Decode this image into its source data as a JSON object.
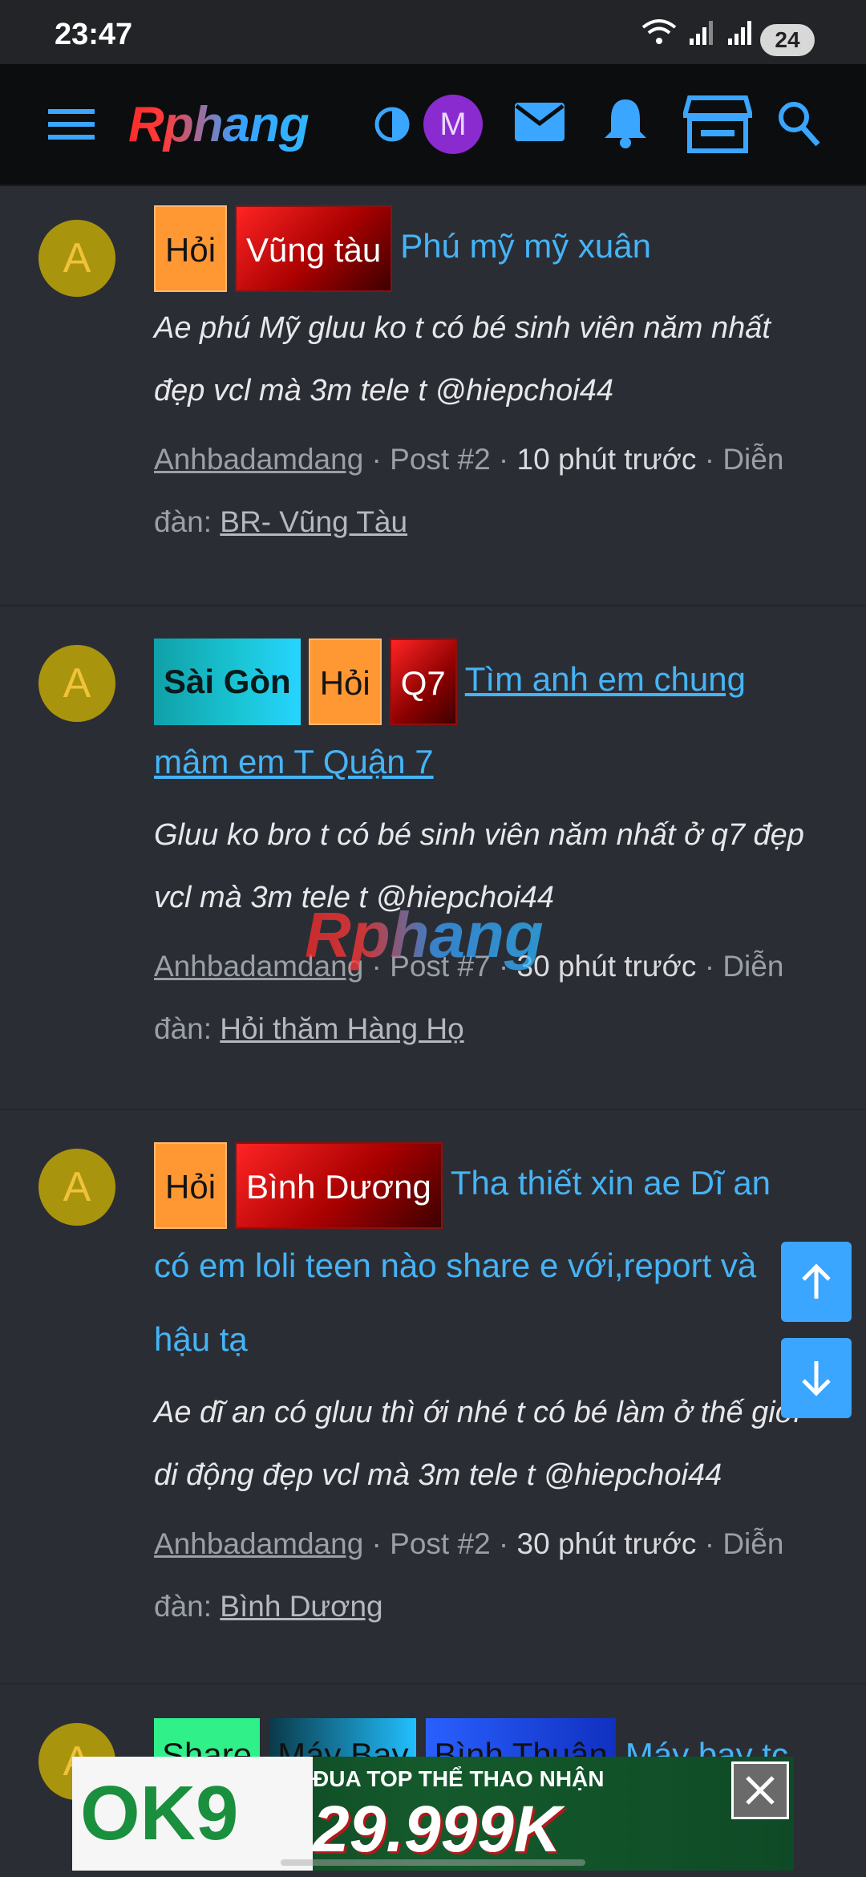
{
  "status_bar": {
    "time": "23:47",
    "battery": "24"
  },
  "nav": {
    "logo": "Rphang",
    "avatar_initial": "M"
  },
  "posts": [
    {
      "avatar": "A",
      "tags": [
        "Hỏi",
        "Vũng tàu"
      ],
      "title": "Phú mỹ mỹ xuân",
      "snippet": "Ae phú Mỹ gluu ko t có bé sinh viên năm nhất đẹp vcl mà 3m tele t @hiepchoi44",
      "user": "Anhbadamdang",
      "post_no": "Post #2",
      "time": "10 phút trước",
      "forum_label": "Diễn đàn:",
      "forum": "BR- Vũng Tàu"
    },
    {
      "avatar": "A",
      "tags": [
        "Sài Gòn",
        "Hỏi",
        "Q7"
      ],
      "title": "Tìm anh em chung mâm em T Quận 7",
      "snippet": "Gluu ko bro t có bé sinh viên năm nhất ở q7 đẹp vcl mà 3m tele t @hiepchoi44",
      "user": "Anhbadamdang",
      "post_no": "Post #7",
      "time": "30 phút trước",
      "forum_label": "Diễn đàn:",
      "forum": "Hỏi thăm Hàng Họ"
    },
    {
      "avatar": "A",
      "tags": [
        "Hỏi",
        "Bình Dương"
      ],
      "title": "Tha thiết xin ae Dĩ an có em loli teen nào share e với,report và hậu tạ",
      "snippet": "Ae dĩ an có gluu thì ới nhé t có bé làm ở thế giới di động đẹp vcl mà 3m tele t @hiepchoi44",
      "user": "Anhbadamdang",
      "post_no": "Post #2",
      "time": "30 phút trước",
      "forum_label": "Diễn đàn:",
      "forum": "Bình Dương"
    }
  ],
  "post4": {
    "avatar": "A",
    "tags": [
      "Share",
      "Máy Bay",
      "Bình Thuận"
    ],
    "title": "Máy bay tc"
  },
  "watermark": "Rphang",
  "ad": {
    "brand": "OK9",
    "headline": "ĐUA TOP THỂ THAO NHẬN",
    "amount": "29.999K"
  },
  "colors": {
    "link": "#45b4f5",
    "nav_bg": "#0c0d0f",
    "page_bg": "#2b2d35",
    "accent_button": "#3aa6ff"
  }
}
